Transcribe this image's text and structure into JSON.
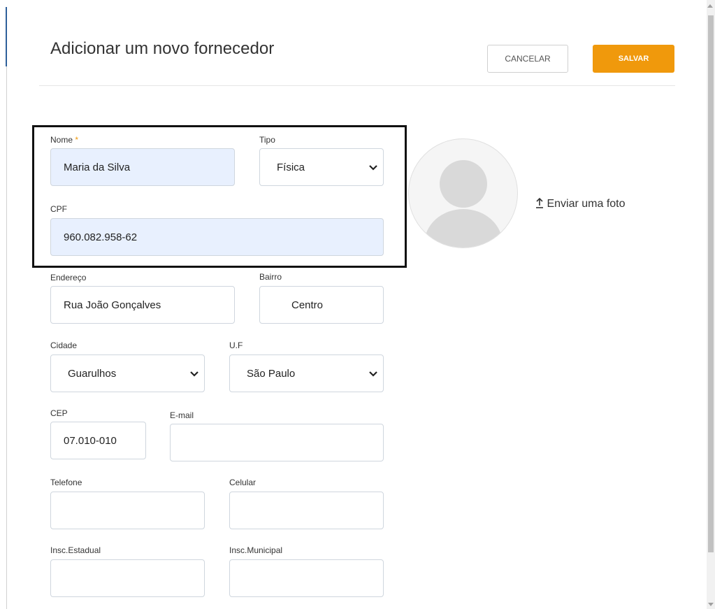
{
  "header": {
    "title": "Adicionar um novo fornecedor",
    "cancel_label": "CANCELAR",
    "save_label": "SALVAR"
  },
  "form": {
    "nome": {
      "label": "Nome",
      "required_mark": "*",
      "value": "Maria da Silva"
    },
    "tipo": {
      "label": "Tipo",
      "value": "Física"
    },
    "cpf": {
      "label": "CPF",
      "value": "960.082.958-62"
    },
    "endereco": {
      "label": "Endereço",
      "value": "Rua João Gonçalves"
    },
    "bairro": {
      "label": "Bairro",
      "value": "Centro"
    },
    "cidade": {
      "label": "Cidade",
      "value": "Guarulhos"
    },
    "uf": {
      "label": "U.F",
      "value": "São Paulo"
    },
    "cep": {
      "label": "CEP",
      "value": "07.010-010"
    },
    "email": {
      "label": "E-mail",
      "value": ""
    },
    "telefone": {
      "label": "Telefone",
      "value": ""
    },
    "celular": {
      "label": "Celular",
      "value": ""
    },
    "insc_estadual": {
      "label": "Insc.Estadual",
      "value": ""
    },
    "insc_municipal": {
      "label": "Insc.Municipal",
      "value": ""
    }
  },
  "photo": {
    "upload_icon": "upload-arrow-icon",
    "upload_label": "Enviar uma foto"
  },
  "colors": {
    "accent": "#f0990c",
    "filled_field": "#e8f0fe"
  }
}
